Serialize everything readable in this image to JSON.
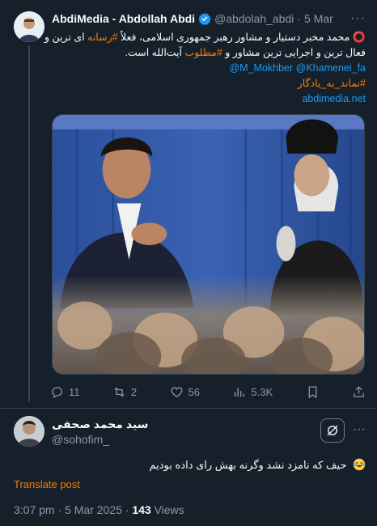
{
  "tweet1": {
    "author_name": "AbdiMedia - Abdollah Abdi",
    "handle": "@abdolah_abdi",
    "date": "5 Mar",
    "body": {
      "line1_text": "محمد مخبر دستیار و مشاور رهبر جمهوری اسلامی، فعلاً ",
      "line1_hashtag": "#رسانه",
      "line1_tail": " ای ترین و",
      "line2_text": "فعال ترین و اجرایی ترین مشاور و ",
      "line2_hashtag": "#مطلوب",
      "line2_tail": " آیت‌الله است.",
      "mentions": "@M_Mokhber @Khamenei_fa",
      "hashtag3": "#نماند_به_یادگار",
      "website": "abdimedia.net"
    },
    "stats": {
      "replies": "11",
      "retweets": "2",
      "likes": "56",
      "views": "5.3K"
    }
  },
  "tweet2": {
    "author_name": "سید محمد صحفی",
    "handle": "@sohofim_",
    "text": "حیف که نامزد نشد وگرنه بهش رای داده بودیم",
    "translate_label": "Translate post",
    "time": "3:07 pm",
    "date": "5 Mar 2025",
    "views_count": "143",
    "views_label": "Views"
  },
  "colors": {
    "background": "#15202b",
    "link": "#1d9bf0",
    "accent_orange": "#ff7a00",
    "muted": "#8b98a5"
  }
}
